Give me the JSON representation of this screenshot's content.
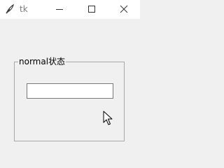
{
  "window": {
    "title": "tk",
    "icons": {
      "app": "feather-icon",
      "minimize": "minimize-icon",
      "maximize": "maximize-icon",
      "close": "close-icon"
    }
  },
  "labelframe": {
    "label": "normal状态"
  },
  "entry": {
    "value": "",
    "state": "normal"
  },
  "colors": {
    "titlebar": "#ffffff",
    "background": "#f0f0f0",
    "border": "#a8a8a8"
  }
}
